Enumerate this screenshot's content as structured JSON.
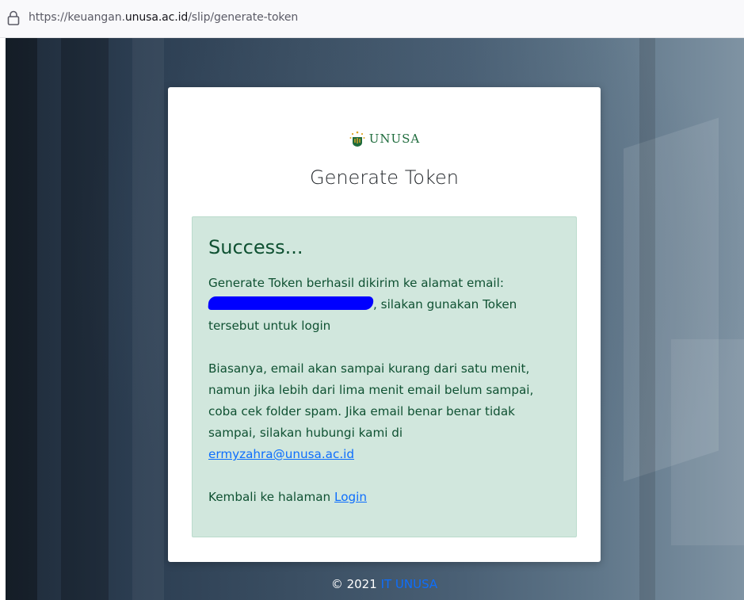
{
  "browser": {
    "url_prefix": "https://keuangan.",
    "url_domain": "unusa.ac.id",
    "url_path": "/slip/generate-token"
  },
  "card": {
    "logo_text": "UNUSA",
    "title": "Generate Token"
  },
  "alert": {
    "heading": "Success...",
    "line1": "Generate Token berhasil dikirim ke alamat email:",
    "line2_suffix": ", silakan gunakan Token tersebut untuk login",
    "paragraph2": "Biasanya, email akan sampai kurang dari satu menit, namun jika lebih dari lima menit email belum sampai, coba cek folder spam. Jika email benar benar tidak sampai, silakan hubungi kami di",
    "contact_email": "ermyzahra@unusa.ac.id",
    "back_prefix": "Kembali ke halaman",
    "login_link": "Login"
  },
  "footer": {
    "copyright": "© 2021",
    "link_text": "IT UNUSA"
  },
  "colors": {
    "alert_bg": "#d1e7dd",
    "alert_text": "#0f5132",
    "link": "#0d6efd",
    "brand_green": "#1e6b3c"
  }
}
